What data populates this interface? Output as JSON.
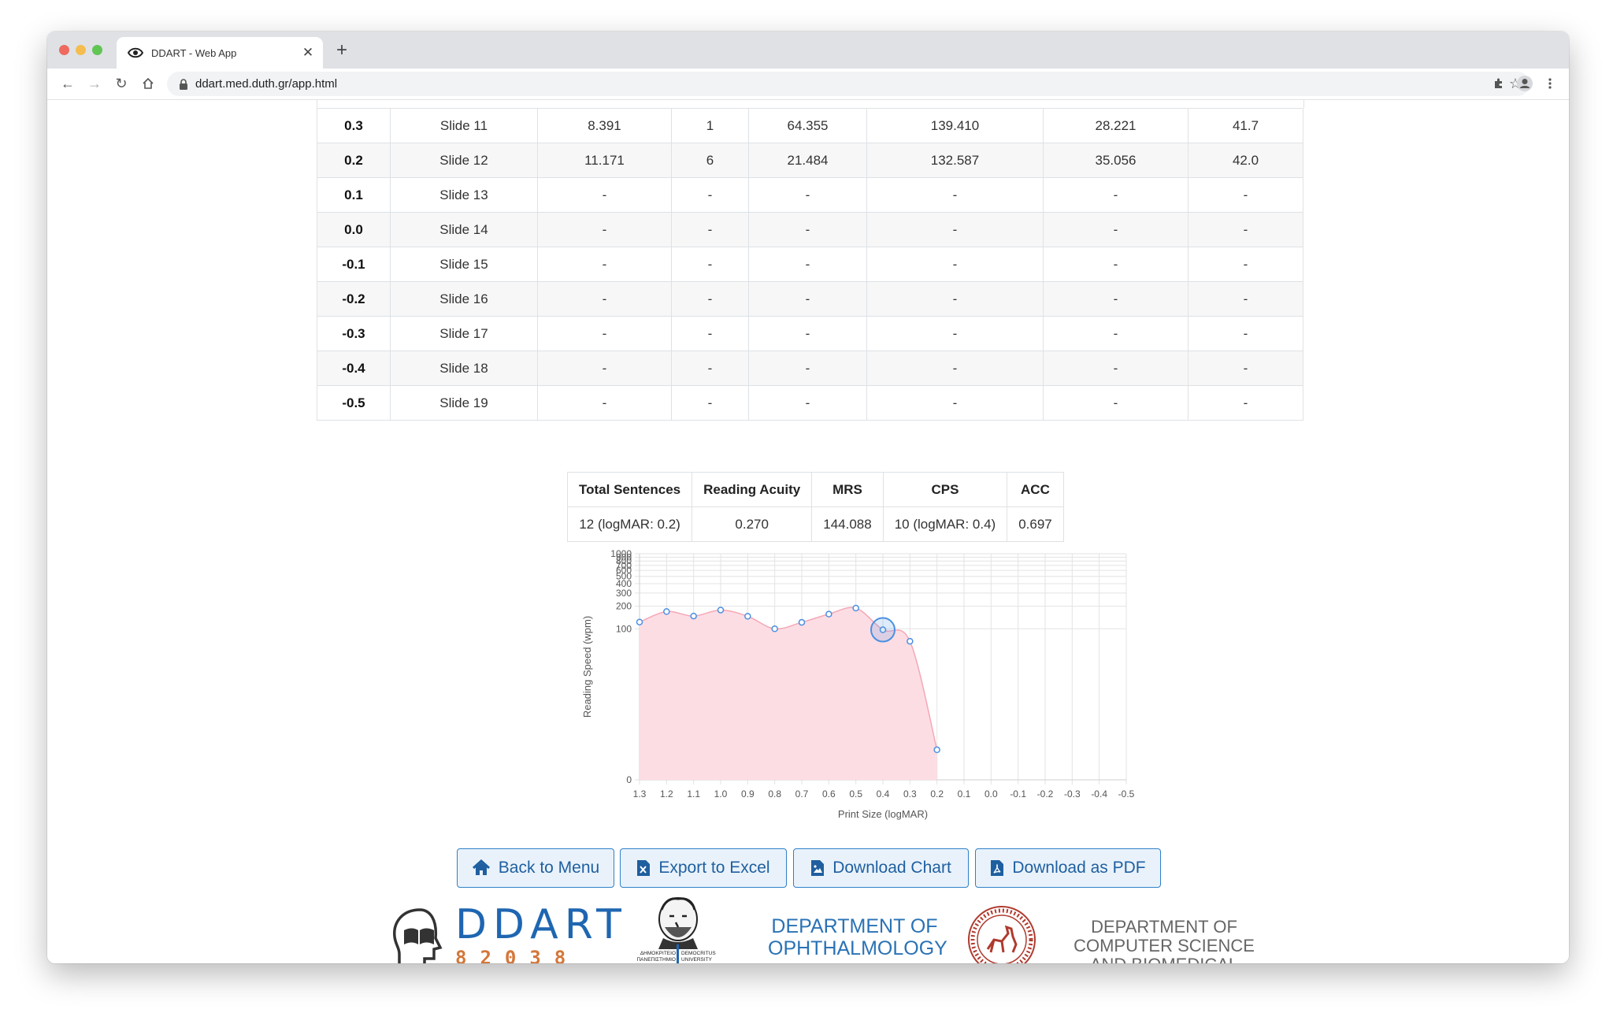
{
  "browser": {
    "tab_title": "DDART - Web App",
    "url": "ddart.med.duth.gr/app.html"
  },
  "results_table": {
    "rows": [
      {
        "logmar": "0.3",
        "slide": "Slide 11",
        "c3": "8.391",
        "c4": "1",
        "c5": "64.355",
        "c6": "139.410",
        "c7": "28.221",
        "c8": "41.7"
      },
      {
        "logmar": "0.2",
        "slide": "Slide 12",
        "c3": "11.171",
        "c4": "6",
        "c5": "21.484",
        "c6": "132.587",
        "c7": "35.056",
        "c8": "42.0"
      },
      {
        "logmar": "0.1",
        "slide": "Slide 13",
        "c3": "-",
        "c4": "-",
        "c5": "-",
        "c6": "-",
        "c7": "-",
        "c8": "-"
      },
      {
        "logmar": "0.0",
        "slide": "Slide 14",
        "c3": "-",
        "c4": "-",
        "c5": "-",
        "c6": "-",
        "c7": "-",
        "c8": "-"
      },
      {
        "logmar": "-0.1",
        "slide": "Slide 15",
        "c3": "-",
        "c4": "-",
        "c5": "-",
        "c6": "-",
        "c7": "-",
        "c8": "-"
      },
      {
        "logmar": "-0.2",
        "slide": "Slide 16",
        "c3": "-",
        "c4": "-",
        "c5": "-",
        "c6": "-",
        "c7": "-",
        "c8": "-"
      },
      {
        "logmar": "-0.3",
        "slide": "Slide 17",
        "c3": "-",
        "c4": "-",
        "c5": "-",
        "c6": "-",
        "c7": "-",
        "c8": "-"
      },
      {
        "logmar": "-0.4",
        "slide": "Slide 18",
        "c3": "-",
        "c4": "-",
        "c5": "-",
        "c6": "-",
        "c7": "-",
        "c8": "-"
      },
      {
        "logmar": "-0.5",
        "slide": "Slide 19",
        "c3": "-",
        "c4": "-",
        "c5": "-",
        "c6": "-",
        "c7": "-",
        "c8": "-"
      }
    ]
  },
  "summary": {
    "headers": [
      "Total Sentences",
      "Reading Acuity",
      "MRS",
      "CPS",
      "ACC"
    ],
    "values": [
      "12 (logMAR: 0.2)",
      "0.270",
      "144.088",
      "10 (logMAR: 0.4)",
      "0.697"
    ]
  },
  "chart_data": {
    "type": "area",
    "xlabel": "Print Size (logMAR)",
    "ylabel": "Reading Speed (wpm)",
    "x_ticks": [
      "1.3",
      "1.2",
      "1.1",
      "1.0",
      "0.9",
      "0.8",
      "0.7",
      "0.6",
      "0.5",
      "0.4",
      "0.3",
      "0.2",
      "0.1",
      "0.0",
      "-0.1",
      "-0.2",
      "-0.3",
      "-0.4",
      "-0.5"
    ],
    "y_scale": "log",
    "y_ticks": [
      0,
      100,
      200,
      300,
      400,
      500,
      600,
      700,
      800,
      900,
      1000
    ],
    "y_tick_labels": [
      "0",
      "100",
      "200",
      "300",
      "400",
      "500",
      "600",
      "700",
      "800",
      "900",
      "1000"
    ],
    "grid": true,
    "series": [
      {
        "x": [
          1.3,
          1.2,
          1.1,
          1.0,
          0.9,
          0.8,
          0.7,
          0.6,
          0.5,
          0.4,
          0.3,
          0.2
        ],
        "y": [
          123,
          170,
          148,
          178,
          147,
          100,
          122,
          157,
          189,
          97,
          68,
          1.5
        ]
      }
    ],
    "highlight": {
      "x": 0.4,
      "y": 97
    },
    "colors": {
      "fill": "#fddde4",
      "line": "#f4a7b6",
      "point": "#4a90e2"
    }
  },
  "buttons": {
    "back": "Back to Menu",
    "excel": "Export to Excel",
    "chart": "Download Chart",
    "pdf": "Download as PDF"
  },
  "footer": {
    "ddart_logo_text": "DDART",
    "ddart_logo_sub": "82038",
    "duth_gr": "ΔΗΜΟΚΡΙΤΕΙΟ ΠΑΝΕΠΙΣΤΗΜΙΟ ΘΡΑΚΗΣ",
    "duth_en": "DEMOCRITUS UNIVERSITY OF THRACE",
    "ophth_line1": "DEPARTMENT OF",
    "ophth_line2": "OPHTHALMOLOGY",
    "cs_line1": "DEPARTMENT OF",
    "cs_line2": "COMPUTER SCIENCE",
    "cs_line3": "AND BIOMEDICAL INFORMATICS"
  }
}
